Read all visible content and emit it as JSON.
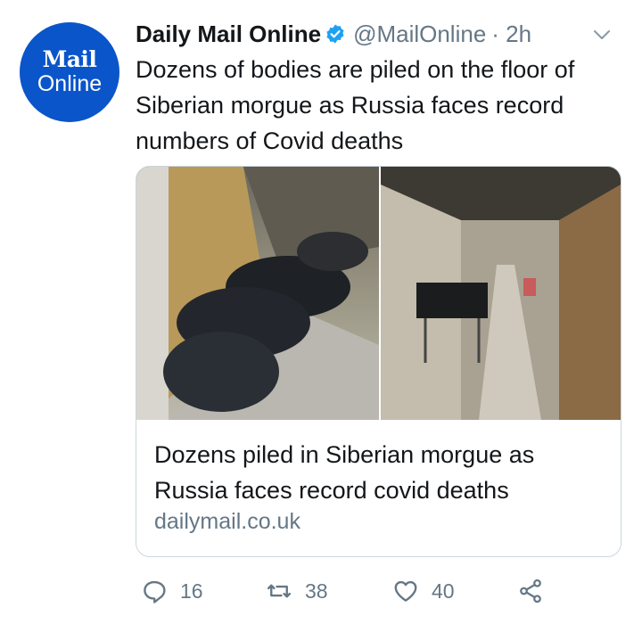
{
  "account": {
    "avatar_line1": "Mail",
    "avatar_line2": "Online",
    "name": "Daily Mail Online",
    "handle": "@MailOnline",
    "time": "· 2h"
  },
  "tweet": {
    "text": "Dozens of bodies are piled on the floor of Siberian morgue as Russia faces record numbers of Covid deaths"
  },
  "card": {
    "title": "Dozens piled in Siberian morgue as Russia faces record covid deaths",
    "domain": "dailymail.co.uk"
  },
  "actions": {
    "replies": "16",
    "retweets": "38",
    "likes": "40"
  },
  "colors": {
    "brand": "#0a55c9",
    "verified": "#1da1f2",
    "muted": "#657786"
  }
}
